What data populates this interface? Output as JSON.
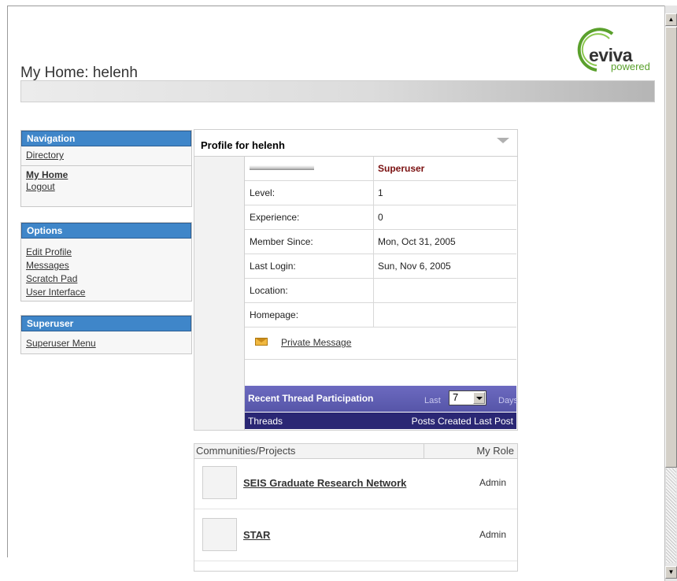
{
  "header": {
    "title": "My Home: helenh",
    "logo_word": "eviva",
    "logo_sub": "powered"
  },
  "navigation": {
    "heading": "Navigation",
    "items": [
      "Directory"
    ],
    "current": "My Home",
    "logout": "Logout"
  },
  "options": {
    "heading": "Options",
    "items": [
      "Edit Profile",
      "Messages",
      "Scratch Pad",
      "User Interface"
    ]
  },
  "superuser_box": {
    "heading": "Superuser",
    "items": [
      "Superuser Menu"
    ]
  },
  "profile": {
    "title": "Profile for helenh",
    "rank": "Superuser",
    "fields": [
      {
        "label": "Level:",
        "value": "1"
      },
      {
        "label": "Experience:",
        "value": "0"
      },
      {
        "label": "Member Since:",
        "value": "Mon, Oct 31, 2005"
      },
      {
        "label": "Last Login:",
        "value": "Sun, Nov 6, 2005"
      },
      {
        "label": "Location:",
        "value": ""
      },
      {
        "label": "Homepage:",
        "value": ""
      }
    ],
    "private_message": "Private Message",
    "recent": {
      "title": "Recent Thread Participation",
      "last_label": "Last",
      "days_value": "7",
      "days_label": "Days"
    },
    "threads_header": {
      "threads": "Threads",
      "right": "Posts  Created  Last Post"
    }
  },
  "communities": {
    "header_left": "Communities/Projects",
    "header_right": "My Role",
    "rows": [
      {
        "name": "SEIS Graduate Research Network",
        "role": "Admin"
      },
      {
        "name": "STAR",
        "role": "Admin"
      }
    ]
  },
  "colors": {
    "nav_header": "#3f86c9",
    "recent_bar": "#5655a8",
    "threads_bar": "#2a2774",
    "superuser_text": "#7a1010",
    "logo_green": "#5aa02c"
  },
  "icons": [
    "envelope-icon",
    "chevron-down-icon",
    "eviva-logo"
  ]
}
